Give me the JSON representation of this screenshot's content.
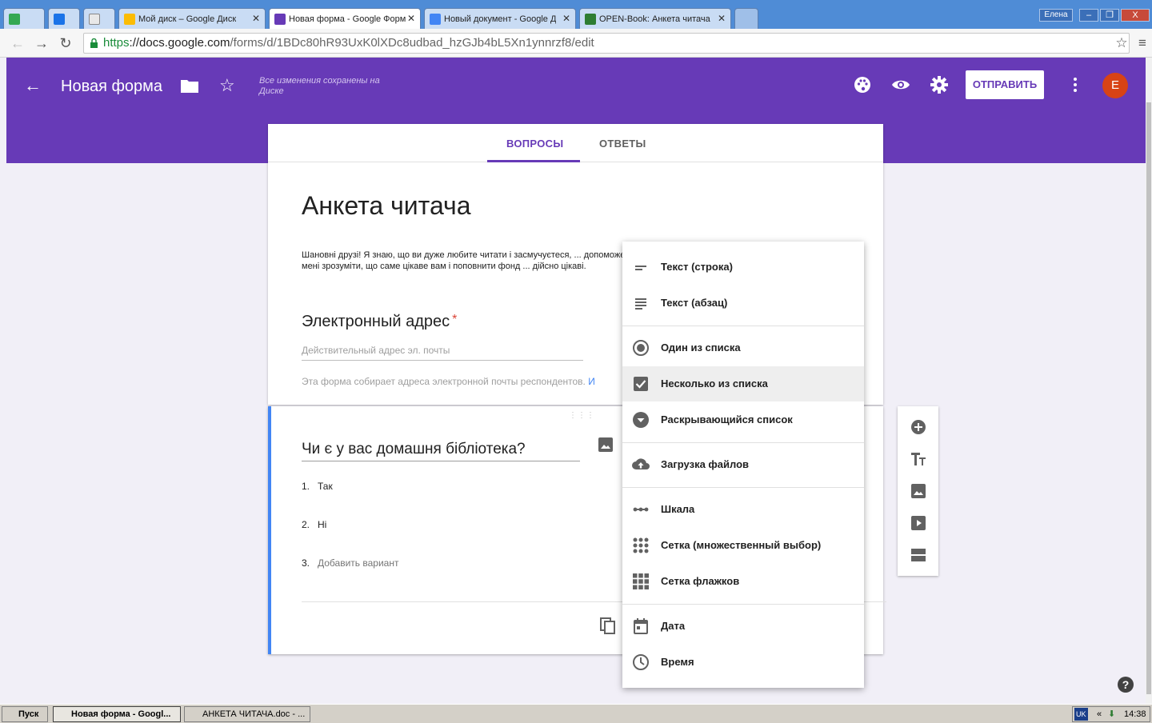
{
  "browser": {
    "tabs": [
      {
        "title": "",
        "fav_color": "#34a853",
        "active": false
      },
      {
        "title": "",
        "fav_color": "#1a73e8",
        "active": false
      },
      {
        "title": "",
        "fav_color": "#e8e8e8",
        "active": false
      },
      {
        "title": "Мой диск – Google Диск",
        "fav_color": "#fbbc05",
        "active": false
      },
      {
        "title": "Новая форма - Google Форм",
        "fav_color": "#673ab7",
        "active": true
      },
      {
        "title": "Новый документ - Google Д",
        "fav_color": "#4285f4",
        "active": false
      },
      {
        "title": "OPEN-Book: Анкета читача",
        "fav_color": "#2e7d32",
        "active": false
      }
    ],
    "user_label": "Елена",
    "url_scheme": "https",
    "url_host": "://docs.google.com",
    "url_path": "/forms/d/1BDc80hR93UxK0lXDc8udbad_hzGJb4bL5Xn1ynnrzf8/edit"
  },
  "header": {
    "form_title": "Новая форма",
    "saved_note": "Все изменения сохранены на Диске",
    "send_label": "ОТПРАВИТЬ",
    "avatar_letter": "E",
    "accent": "#673ab7"
  },
  "tabs": {
    "questions": "ВОПРОСЫ",
    "responses": "ОТВЕТЫ"
  },
  "form": {
    "title": "Анкета читача",
    "description": "Шановні друзі!  Я знаю, що ви дуже любите читати і засмучуєтеся, ... допоможе мені зрозуміти, що саме цікаве вам і поповнити фонд ... дійсно цікаві.",
    "email_label": "Электронный адрес",
    "email_required": "*",
    "email_placeholder": "Действительный адрес эл. почты",
    "email_note": "Эта форма собирает адреса электронной почты респондентов.",
    "email_note_link": "И"
  },
  "question": {
    "title": "Чи є у вас домашня бібліотека?",
    "options": [
      {
        "num": "1.",
        "label": "Так"
      },
      {
        "num": "2.",
        "label": "Ні"
      },
      {
        "num": "3.",
        "label": "Добавить вариант"
      }
    ]
  },
  "type_menu": {
    "items": [
      {
        "label": "Текст (строка)",
        "icon": "short-text-icon"
      },
      {
        "label": "Текст (абзац)",
        "icon": "paragraph-icon"
      },
      {
        "label": "Один из списка",
        "icon": "radio-icon"
      },
      {
        "label": "Несколько из списка",
        "icon": "checkbox-icon",
        "highlighted": true
      },
      {
        "label": "Раскрывающийся список",
        "icon": "dropdown-icon"
      },
      {
        "label": "Загрузка файлов",
        "icon": "upload-icon"
      },
      {
        "label": "Шкала",
        "icon": "scale-icon"
      },
      {
        "label": "Сетка (множественный выбор)",
        "icon": "grid-icon"
      },
      {
        "label": "Сетка флажков",
        "icon": "checkbox-grid-icon"
      },
      {
        "label": "Дата",
        "icon": "calendar-icon"
      },
      {
        "label": "Время",
        "icon": "clock-icon"
      }
    ]
  },
  "taskbar": {
    "start": "Пуск",
    "items": [
      {
        "label": "Новая форма - Googl..."
      },
      {
        "label": "АНКЕТА ЧИТАЧА.doc - ..."
      }
    ],
    "lang": "UK",
    "time": "14:38"
  }
}
